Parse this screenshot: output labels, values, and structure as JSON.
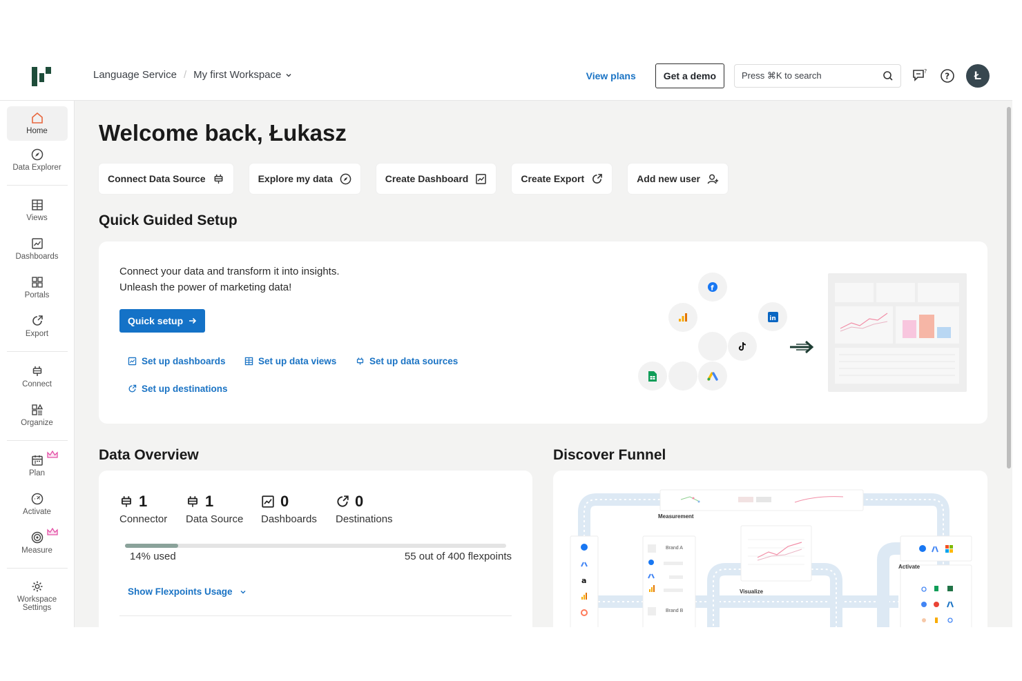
{
  "header": {
    "breadcrumb_org": "Language Service",
    "breadcrumb_workspace": "My first Workspace",
    "view_plans": "View plans",
    "get_demo": "Get a demo",
    "search_placeholder": "Press ⌘K to search",
    "avatar_initial": "Ł"
  },
  "sidebar": {
    "home": "Home",
    "data_explorer": "Data Explorer",
    "views": "Views",
    "dashboards": "Dashboards",
    "portals": "Portals",
    "export": "Export",
    "connect": "Connect",
    "organize": "Organize",
    "plan": "Plan",
    "activate": "Activate",
    "measure": "Measure",
    "workspace_settings": "Workspace Settings"
  },
  "main": {
    "welcome": "Welcome back, Łukasz",
    "actions": [
      "Connect Data Source",
      "Explore my data",
      "Create Dashboard",
      "Create Export",
      "Add new user"
    ],
    "quick_setup_title": "Quick Guided Setup",
    "quick_setup_line1": "Connect your data and transform it into insights.",
    "quick_setup_line2": "Unleash the power of marketing data!",
    "quick_setup_button": "Quick setup",
    "links": [
      "Set up dashboards",
      "Set up data views",
      "Set up data sources",
      "Set up destinations"
    ],
    "data_overview_title": "Data Overview",
    "discover_funnel_title": "Discover Funnel",
    "stats": [
      {
        "value": "1",
        "label": "Connector"
      },
      {
        "value": "1",
        "label": "Data Source"
      },
      {
        "value": "0",
        "label": "Dashboards"
      },
      {
        "value": "0",
        "label": "Destinations"
      }
    ],
    "usage_pct": 14,
    "usage_used": "14% used",
    "usage_total": "55 out of 400 flexpoints",
    "show_usage": "Show Flexpoints Usage",
    "funnel_labels": {
      "measurement": "Measurement",
      "visualize": "Visualize",
      "activate": "Activate",
      "brand_a": "Brand A",
      "brand_b": "Brand B"
    }
  },
  "colors": {
    "accent_blue": "#1472c7",
    "brand_green": "#1e4d3a",
    "home_orange": "#e8663d",
    "premium_pink": "#e34fa6"
  }
}
